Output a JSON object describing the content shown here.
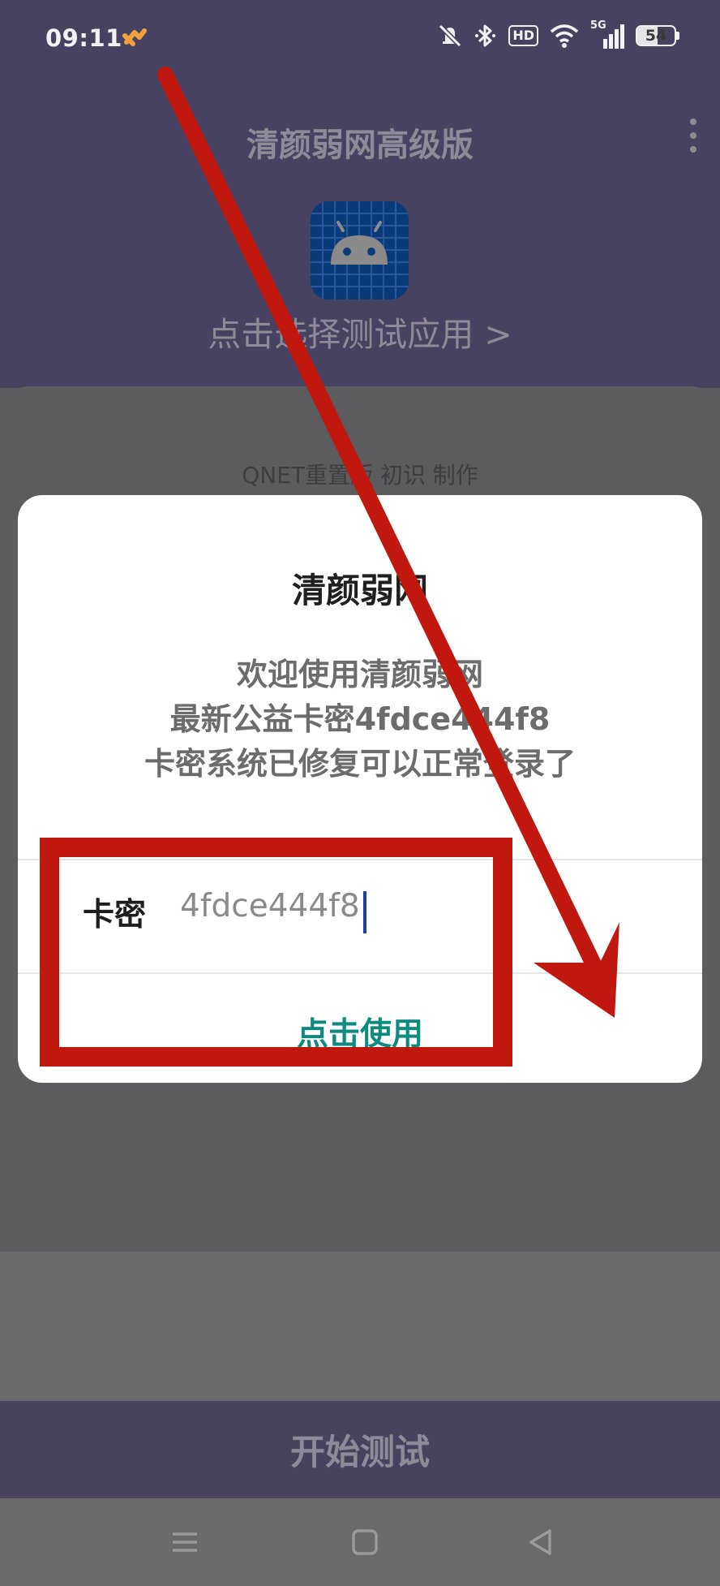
{
  "status_bar": {
    "time": "09:11",
    "battery_percent": "54",
    "network": "5G",
    "hd_label": "HD",
    "icons": [
      "health-icon",
      "mute-icon",
      "bluetooth-icon",
      "wifi-icon",
      "signal-icon",
      "battery-icon"
    ]
  },
  "app_bar": {
    "title": "清颜弱网高级版",
    "menu_icon": "more-vert-icon"
  },
  "app_picker": {
    "icon": "android-icon",
    "label": "点击选择测试应用 >"
  },
  "credit": "QNET重置版 初识 制作",
  "dialog": {
    "title": "清颜弱网",
    "message_lines": [
      "欢迎使用清颜弱网",
      "最新公益卡密4fdce444f8",
      "卡密系统已修复可以正常登录了"
    ],
    "field_label": "卡密",
    "field_value": "4fdce444f8",
    "use_button": "点击使用"
  },
  "start_button": "开始测试",
  "nav_bar": {
    "icons": [
      "menu-icon",
      "home-icon",
      "back-icon"
    ]
  },
  "annotation": {
    "color": "#c0170f"
  }
}
